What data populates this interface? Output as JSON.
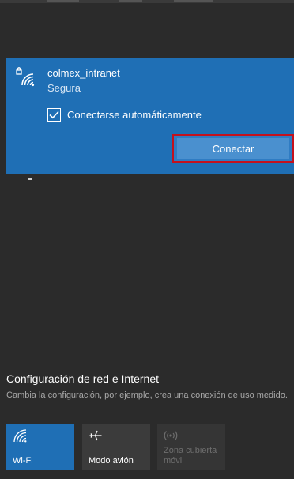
{
  "network": {
    "name": "colmex_intranet",
    "status": "Segura",
    "auto_connect_label": "Conectarse automáticamente",
    "auto_connect_checked": true,
    "connect_label": "Conectar"
  },
  "settings": {
    "title": "Configuración de red e Internet",
    "description": "Cambia la configuración, por ejemplo, crea una conexión de uso medido."
  },
  "quick_actions": [
    {
      "label": "Wi-Fi",
      "icon": "wifi-icon",
      "active": true
    },
    {
      "label": "Modo avión",
      "icon": "airplane-icon",
      "active": false
    },
    {
      "label": "Zona cubierta móvil",
      "icon": "hotspot-icon",
      "active": false,
      "disabled": true
    }
  ],
  "colors": {
    "accent": "#1f6fb5",
    "background": "#2b2b2b",
    "highlight_border": "#c4111d"
  }
}
